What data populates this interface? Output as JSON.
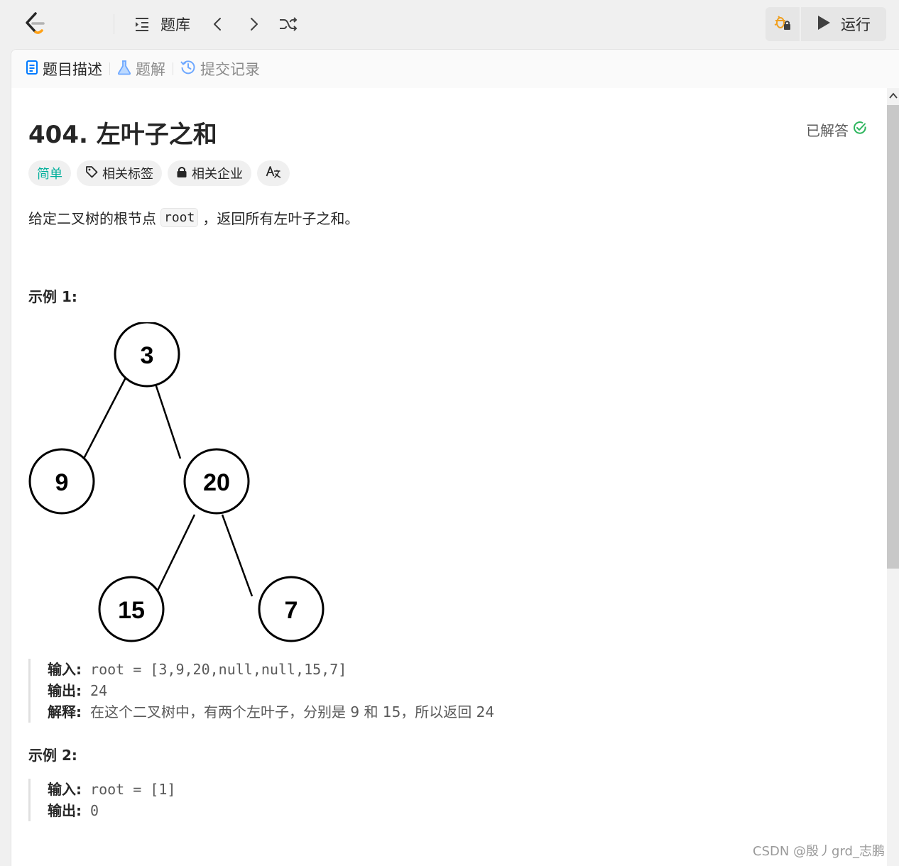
{
  "topbar": {
    "problem_list_label": "题库",
    "run_label": "运行"
  },
  "tabs": [
    {
      "label": "题目描述",
      "icon": "description-icon"
    },
    {
      "label": "题解",
      "icon": "flask-icon"
    },
    {
      "label": "提交记录",
      "icon": "history-icon"
    }
  ],
  "problem": {
    "title": "404. 左叶子之和",
    "status": "已解答",
    "tags": {
      "difficulty": "简单",
      "related_tags": "相关标签",
      "related_companies": "相关企业"
    },
    "desc_before": "给定二叉树的根节点",
    "desc_code": "root",
    "desc_after": "，返回所有左叶子之和。"
  },
  "example1": {
    "title": "示例 1:",
    "tree_nodes": [
      "3",
      "9",
      "20",
      "15",
      "7"
    ],
    "input_label": "输入:",
    "input_value": "root = [3,9,20,null,null,15,7]",
    "output_label": "输出:",
    "output_value": "24",
    "explain_label": "解释:",
    "explain_value": "在这个二叉树中，有两个左叶子，分别是 9 和 15，所以返回 24"
  },
  "example2": {
    "title": "示例 2:",
    "input_label": "输入:",
    "input_value": "root = [1]",
    "output_label": "输出:",
    "output_value": "0"
  },
  "watermark": "CSDN @殷丿grd_志鹏",
  "colors": {
    "easy": "#00af9b",
    "solved_check": "#2db55d",
    "debug_icon": "#f0a020"
  }
}
